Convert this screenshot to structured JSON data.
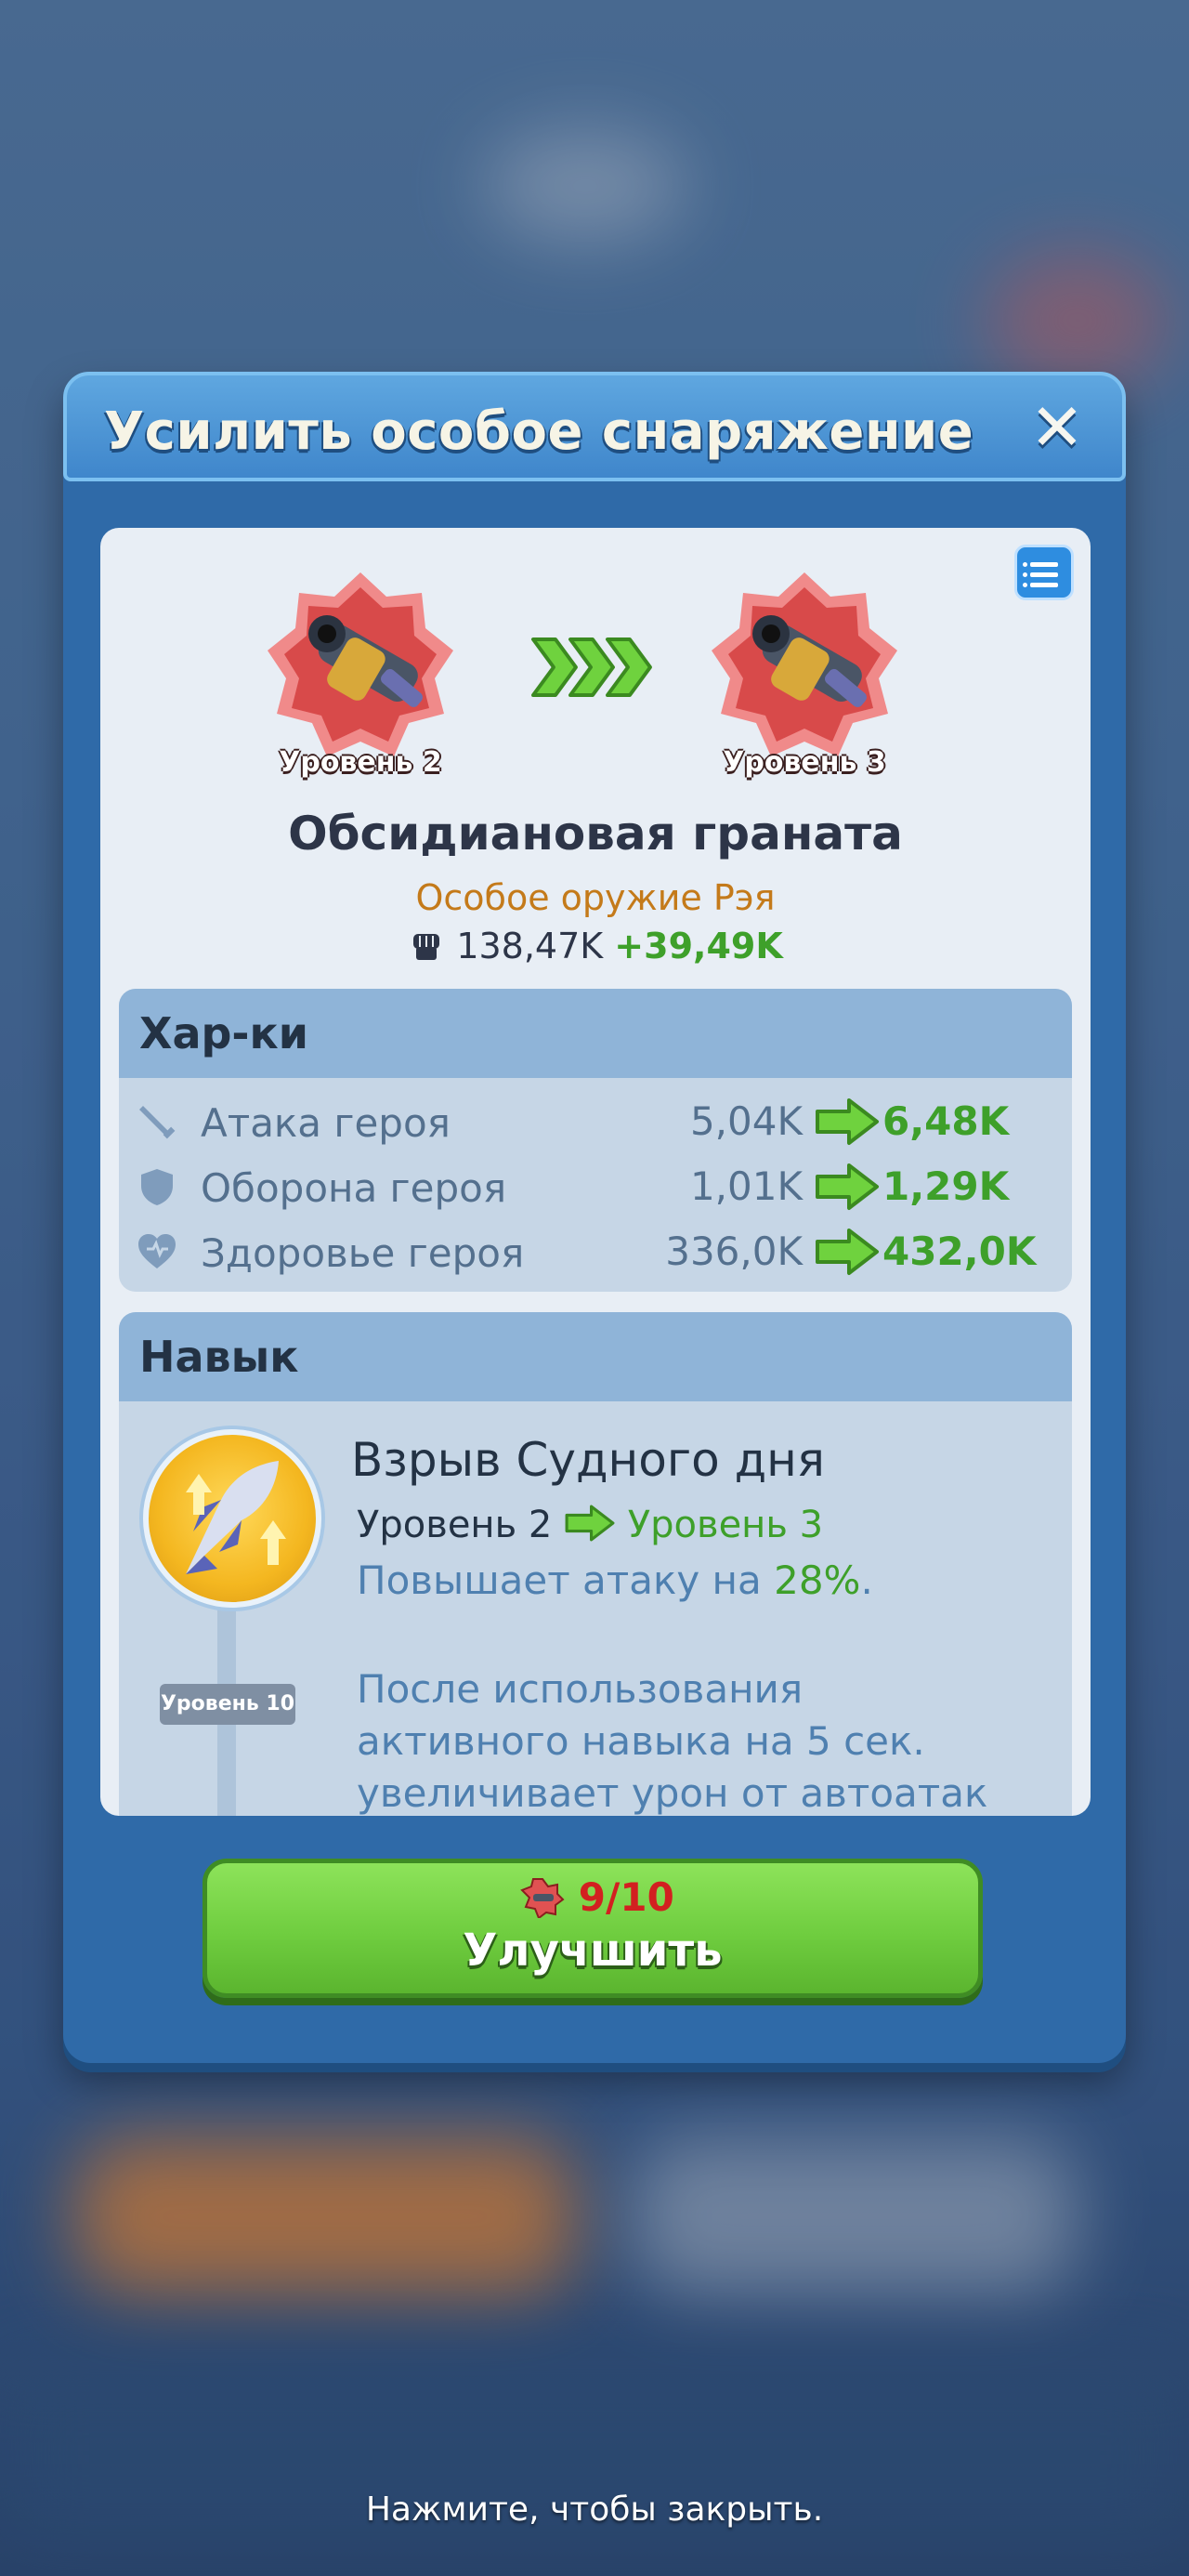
{
  "modal": {
    "title": "Усилить особое снаряжение",
    "close_icon": "close-icon"
  },
  "item": {
    "level_from": "Уровень 2",
    "level_to": "Уровень 3",
    "name": "Обсидиановая граната",
    "type": "Особое оружие Рэя",
    "power": "138,47K",
    "power_gain": "+39,49K"
  },
  "stats": {
    "header": "Хар-ки",
    "rows": [
      {
        "label": "Атака героя",
        "old": "5,04K",
        "new": "6,48K",
        "icon": "sword-icon"
      },
      {
        "label": "Оборона героя",
        "old": "1,01K",
        "new": "1,29K",
        "icon": "shield-icon"
      },
      {
        "label": "Здоровье героя",
        "old": "336,0K",
        "new": "432,0K",
        "icon": "heart-icon"
      }
    ]
  },
  "skill": {
    "header": "Навык",
    "name": "Взрыв Судного дня",
    "level_from": "Уровень 2",
    "level_to": "Уровень 3",
    "desc_prefix": "Повышает атаку на ",
    "desc_pct": "28%",
    "desc_suffix": ".",
    "unlock_tag": "Уровень 10",
    "long_desc": "После использования активного навыка на 5 сек. увеличивает урон от автоатак"
  },
  "upgrade": {
    "cost": "9/10",
    "label": "Улучшить"
  },
  "footer": {
    "hint": "Нажмите, чтобы закрыть."
  },
  "colors": {
    "accent_green": "#3ea02a",
    "modal_blue": "#2f6aa8",
    "gear_red": "#e05252"
  }
}
